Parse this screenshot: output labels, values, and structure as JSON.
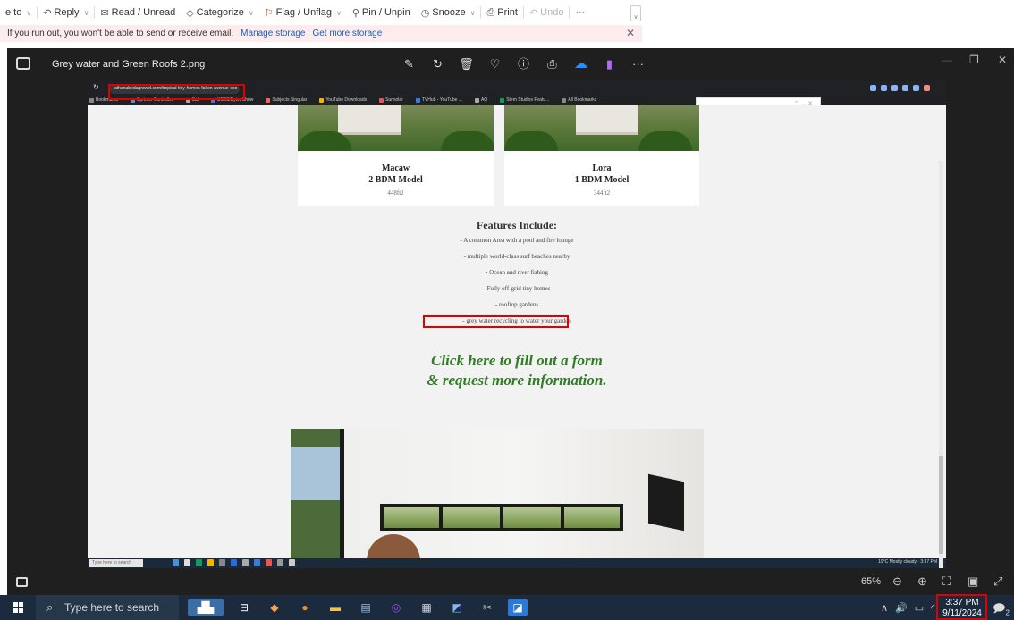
{
  "outlook": {
    "ribbon": {
      "move_to": "e to",
      "reply": "Reply",
      "read_unread": "Read / Unread",
      "categorize": "Categorize",
      "flag_unflag": "Flag / Unflag",
      "pin_unpin": "Pin / Unpin",
      "snooze": "Snooze",
      "print": "Print",
      "undo": "Undo",
      "more": "···"
    },
    "banner": {
      "message": "If you run out, you won't be able to send or receive email.",
      "manage_storage": "Manage storage",
      "get_more_storage": "Get more storage"
    }
  },
  "viewer": {
    "file_name": "Grey water and Green Roofs 2.png",
    "zoom_level": "65%"
  },
  "browser": {
    "url": "athanabedagrowel.com/tropical-tiny-homes-fakon-avenue-eco",
    "bookmarks": [
      "Bookmarks",
      "Sprinter Controller",
      "Sal",
      "USBS/Byter Show",
      "Subjects Singular",
      "YouTube Downloads",
      "Sunsolar",
      "TVHub - YouTube ...",
      "AQ",
      "Stem Studios Featu...",
      "All Bookmarks"
    ]
  },
  "webpage": {
    "cards": [
      {
        "name": "Macaw",
        "model": "2 BDM Model",
        "size": "448ft2"
      },
      {
        "name": "Lora",
        "model": "1 BDM Model",
        "size": "344ft2"
      }
    ],
    "features_title": "Features Include:",
    "features": [
      "- A common Area with a pool and fire lounge",
      "- multiple world-class surf beaches nearby",
      "- Ocean and river fishing",
      "- Fully off-grid tiny homes",
      "- rooftop gardens",
      "- grey water recycling to water your garden"
    ],
    "cta_line1": "Click here to fill out a form",
    "cta_line2": "& request more information."
  },
  "inner_taskbar": {
    "search_placeholder": "Type here to search",
    "tray_text": "19°C Mostly cloudy",
    "clock": "3:37 PM"
  },
  "taskbar": {
    "search_placeholder": "Type here to search",
    "time": "3:37 PM",
    "date": "9/11/2024",
    "notification_count": "2"
  }
}
